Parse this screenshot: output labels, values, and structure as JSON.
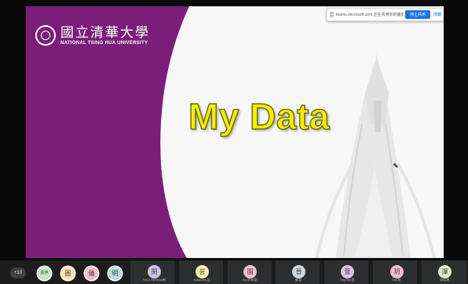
{
  "slide": {
    "title": "My Data",
    "logo_cn": "國立清華大學",
    "logo_en": "NATIONAL TSING HUA UNIVERSITY",
    "colors": {
      "purple": "#7b1e7a",
      "title_yellow": "#f3ef00"
    }
  },
  "share_bar": {
    "message": "teams.microsoft.com 正在共用你的畫面。",
    "stop_label": "停止共用",
    "hide_label": "隱藏"
  },
  "participants": {
    "more_label": "+10",
    "people": [
      {
        "initial": "薏萍",
        "name": "",
        "color": "#c8e6c9"
      },
      {
        "initial": "圓",
        "name": "",
        "color": "#ffe0b2"
      },
      {
        "initial": "儀",
        "name": "",
        "color": "#f8bbd0"
      },
      {
        "initial": "明",
        "name": "",
        "color": "#b2dfdb"
      },
      {
        "initial": "閔",
        "name": "TKU-T.TW HUA 閔",
        "color": "#d1c4e9"
      },
      {
        "initial": "芸",
        "name": "a.shao tch 芸",
        "color": "#ffecb3"
      },
      {
        "initial": "園",
        "name": "Tsu 洪 家 園",
        "color": "#f8bbd0"
      },
      {
        "initial": "晉",
        "name": "陳 晉",
        "color": "#cfd8dc"
      },
      {
        "initial": "萱",
        "name": "Ting Tsai 萱",
        "color": "#e1bee7"
      },
      {
        "initial": "玥",
        "name": "Kuo 玥",
        "color": "#f8bbd0"
      },
      {
        "initial": "澤",
        "name": "Ming 澤",
        "color": "#dcedc8"
      }
    ]
  }
}
